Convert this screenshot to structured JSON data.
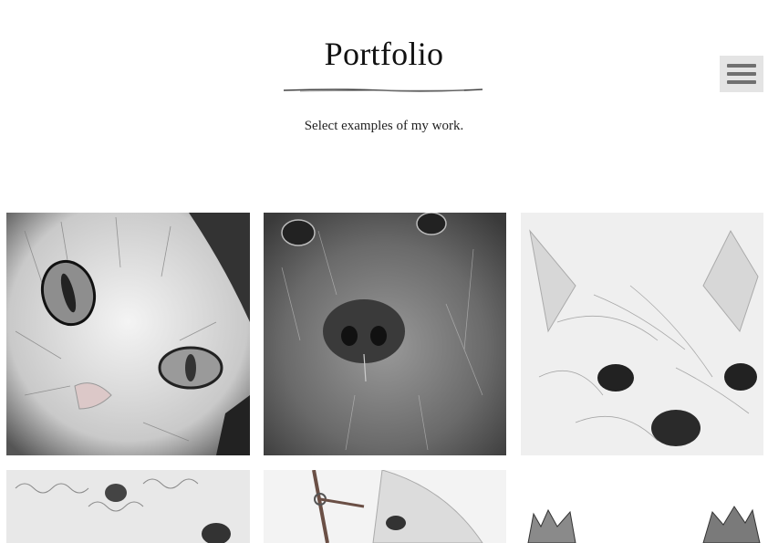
{
  "header": {
    "title": "Portfolio",
    "subtitle": "Select examples of my work."
  },
  "menu": {
    "icon": "hamburger-menu-icon"
  },
  "gallery": {
    "items": [
      {
        "subject": "cat",
        "icon": "cat-drawing"
      },
      {
        "subject": "spaniel",
        "icon": "dog-drawing"
      },
      {
        "subject": "yorkshire terrier",
        "icon": "dog-drawing"
      },
      {
        "subject": "curly dog",
        "icon": "dog-drawing"
      },
      {
        "subject": "horse with halter",
        "icon": "horse-drawing"
      },
      {
        "subject": "two foals",
        "icon": "horse-drawing"
      }
    ]
  },
  "colors": {
    "background": "#ffffff",
    "menu_bg": "#e4e4e4",
    "menu_bars": "#707070",
    "text": "#111111"
  }
}
